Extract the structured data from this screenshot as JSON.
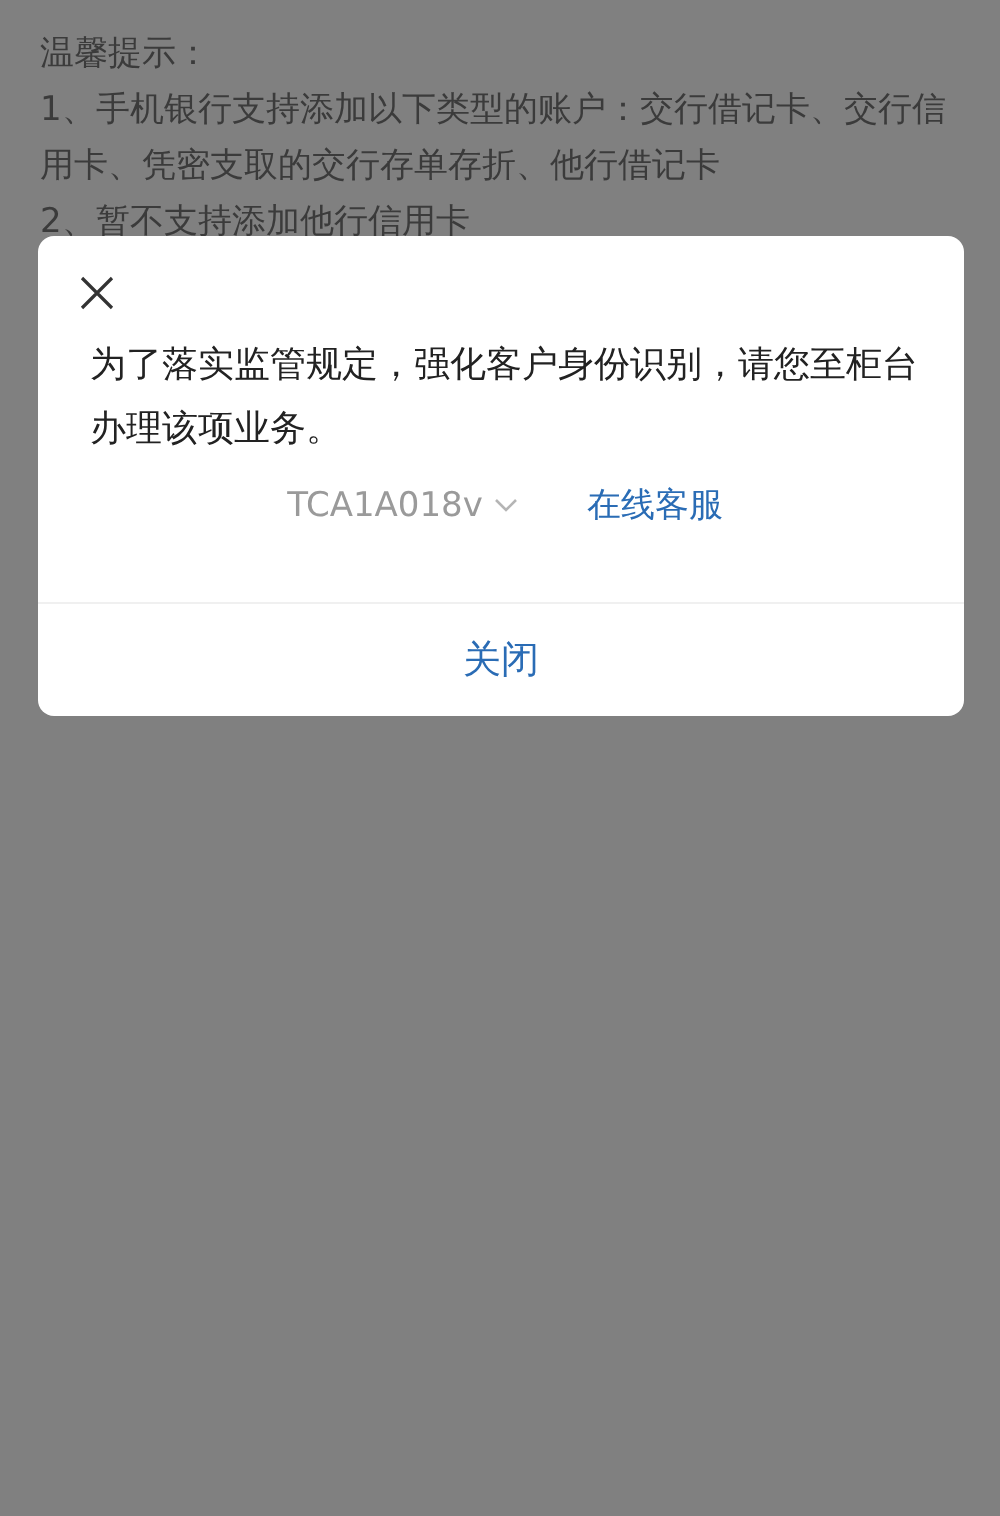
{
  "notice": {
    "title": "温馨提示：",
    "items": [
      "1、手机银行支持添加以下类型的账户：交行借记卡、交行信用卡、凭密支取的交行存单存折、他行借记卡",
      "2、暂不支持添加他行信用卡"
    ]
  },
  "dialog": {
    "message": "为了落实监管规定，强化客户身份识别，请您至柜台办理该项业务。",
    "code": "TCA1A018v",
    "link": "在线客服",
    "button": "关闭"
  }
}
